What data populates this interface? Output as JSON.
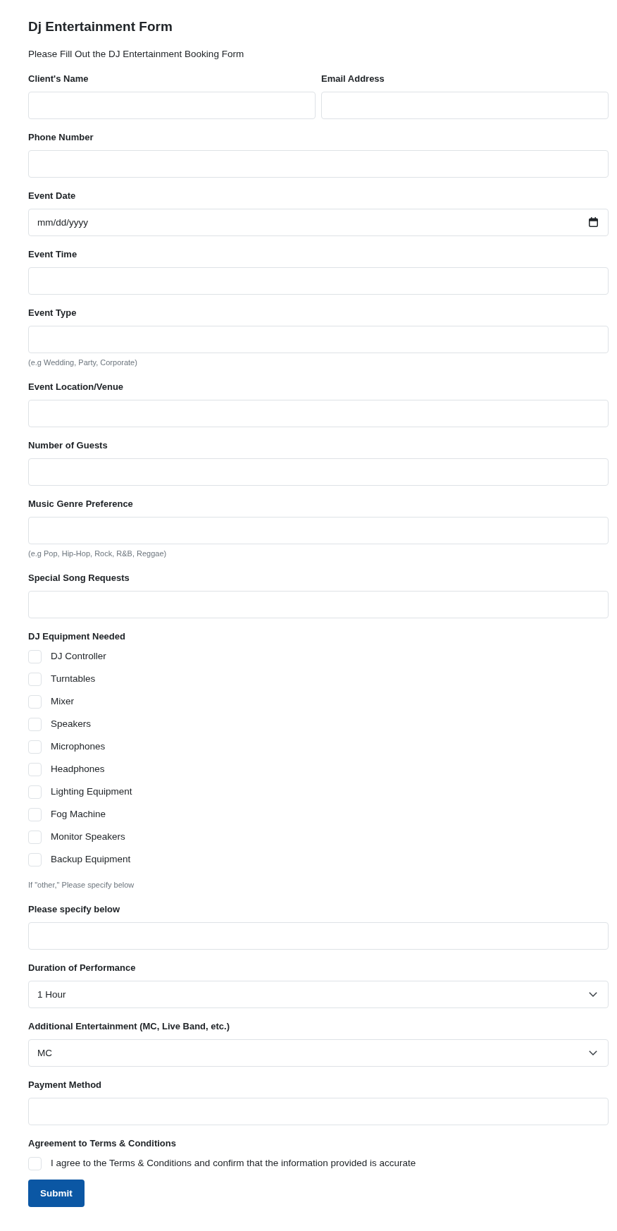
{
  "title": "Dj Entertainment Form",
  "subtitle": "Please Fill Out the DJ Entertainment Booking Form",
  "rows": [
    {
      "fields": [
        {
          "kind": "text",
          "label": "Client's Name"
        },
        {
          "kind": "text",
          "label": "Email Address"
        }
      ]
    },
    {
      "fields": [
        {
          "kind": "text",
          "label": "Phone Number"
        }
      ]
    },
    {
      "fields": [
        {
          "kind": "date",
          "label": "Event Date",
          "placeholder": "mm/dd/yyyy"
        }
      ]
    },
    {
      "fields": [
        {
          "kind": "text",
          "label": "Event Time"
        }
      ]
    },
    {
      "fields": [
        {
          "kind": "text",
          "label": "Event Type",
          "hint": "(e.g Wedding, Party, Corporate)"
        }
      ]
    },
    {
      "fields": [
        {
          "kind": "text",
          "label": "Event Location/Venue"
        }
      ]
    },
    {
      "fields": [
        {
          "kind": "text",
          "label": "Number of Guests"
        }
      ]
    },
    {
      "fields": [
        {
          "kind": "text",
          "label": "Music Genre Preference",
          "hint": "(e.g Pop, Hip-Hop, Rock, R&B, Reggae)"
        }
      ]
    },
    {
      "fields": [
        {
          "kind": "text",
          "label": "Special Song Requests"
        }
      ]
    },
    {
      "fields": [
        {
          "kind": "checkboxes",
          "label": "DJ Equipment Needed",
          "options": [
            {
              "label": "DJ Controller",
              "checked": false
            },
            {
              "label": "Turntables",
              "checked": false
            },
            {
              "label": "Mixer",
              "checked": false
            },
            {
              "label": "Speakers",
              "checked": false
            },
            {
              "label": "Microphones",
              "checked": false
            },
            {
              "label": "Headphones",
              "checked": false
            },
            {
              "label": "Lighting Equipment",
              "checked": false
            },
            {
              "label": "Fog Machine",
              "checked": false
            },
            {
              "label": "Monitor Speakers",
              "checked": false
            },
            {
              "label": "Backup Equipment",
              "checked": false
            }
          ],
          "hint": "If \"other,\" Please specify below"
        }
      ]
    },
    {
      "fields": [
        {
          "kind": "text",
          "label": "Please specify below"
        }
      ]
    },
    {
      "fields": [
        {
          "kind": "select",
          "label": "Duration of Performance",
          "value": "1 Hour"
        }
      ]
    },
    {
      "fields": [
        {
          "kind": "select",
          "label": "Additional Entertainment (MC, Live Band, etc.)",
          "value": "MC"
        }
      ]
    },
    {
      "fields": [
        {
          "kind": "text",
          "label": "Payment Method"
        }
      ]
    },
    {
      "fields": [
        {
          "kind": "checkboxes",
          "label": "Agreement to Terms & Conditions",
          "options": [
            {
              "label": "I agree to the Terms & Conditions and confirm that the information provided is accurate",
              "checked": false
            }
          ]
        }
      ]
    }
  ],
  "submit_button": {
    "label": "Submit"
  }
}
